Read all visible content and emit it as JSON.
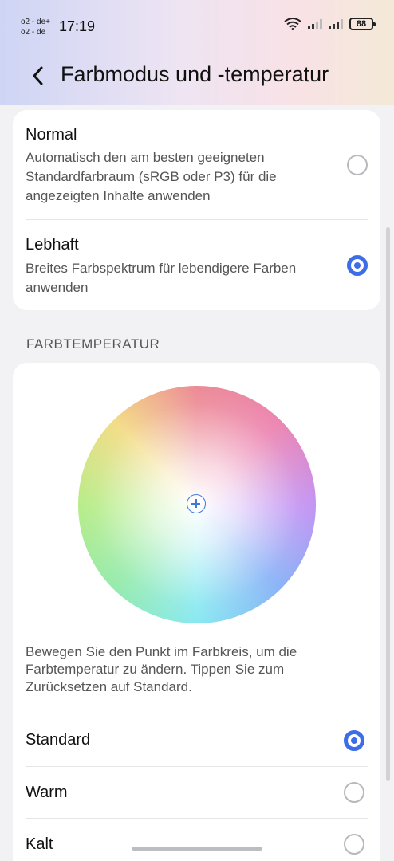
{
  "status_bar": {
    "carrier_line1": "o2 - de+",
    "carrier_line2": "o2 - de",
    "time": "17:19",
    "battery": "88",
    "wifi_icon": "wifi-icon",
    "signal_icon": "signal-icon"
  },
  "header": {
    "title": "Farbmodus und -temperatur",
    "back_icon": "chevron-left-icon"
  },
  "color_mode": {
    "options": [
      {
        "title": "Normal",
        "description": "Automatisch den am besten geeigneten Standardfarbraum (sRGB oder P3) für die angezeigten Inhalte anwenden",
        "selected": false
      },
      {
        "title": "Lebhaft",
        "description": "Breites Farbspektrum für lebendigere Farben anwenden",
        "selected": true
      }
    ]
  },
  "color_temperature": {
    "section_label": "FARBTEMPERATUR",
    "hint": "Bewegen Sie den Punkt im Farbkreis, um die Farbtemperatur zu ändern. Tippen Sie zum Zurücksetzen auf Standard.",
    "options": [
      {
        "label": "Standard",
        "selected": true
      },
      {
        "label": "Warm",
        "selected": false
      },
      {
        "label": "Kalt",
        "selected": false
      }
    ]
  },
  "colors": {
    "accent": "#3d6ee8",
    "background": "#f2f2f4",
    "card": "#ffffff"
  }
}
